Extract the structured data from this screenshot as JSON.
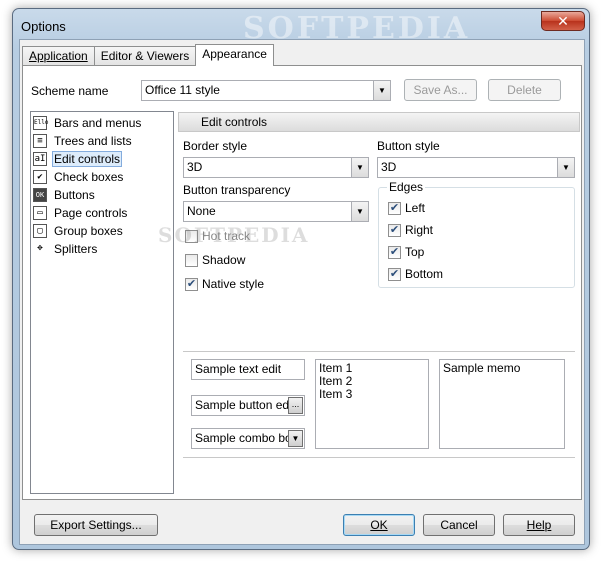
{
  "window": {
    "title": "Options",
    "watermark": "SOFTPEDIA",
    "close_glyph": "✕"
  },
  "tabs": [
    {
      "label": "Application"
    },
    {
      "label": "Editor & Viewers"
    },
    {
      "label": "Appearance"
    }
  ],
  "scheme": {
    "label": "Scheme name",
    "value": "Office 11 style",
    "save_as_label": "Save As...",
    "delete_label": "Delete"
  },
  "tree": [
    {
      "label": "Bars and menus",
      "icon": "Ello"
    },
    {
      "label": "Trees and lists",
      "icon": "≡"
    },
    {
      "label": "Edit controls",
      "icon": "aI"
    },
    {
      "label": "Check boxes",
      "icon": "✔"
    },
    {
      "label": "Buttons",
      "icon": "OK"
    },
    {
      "label": "Page controls",
      "icon": "▭"
    },
    {
      "label": "Group boxes",
      "icon": "▢"
    },
    {
      "label": "Splitters",
      "icon": "✥"
    }
  ],
  "section": {
    "title": "Edit controls",
    "border_style_label": "Border style",
    "border_style_value": "3D",
    "button_style_label": "Button style",
    "button_style_value": "3D",
    "button_transparency_label": "Button transparency",
    "button_transparency_value": "None",
    "checks": {
      "hot_track": "Hot track",
      "shadow": "Shadow",
      "native_style": "Native style"
    },
    "edges_title": "Edges",
    "edges": {
      "left": "Left",
      "right": "Right",
      "top": "Top",
      "bottom": "Bottom"
    }
  },
  "samples": {
    "text_edit": "Sample text edit",
    "button_edit": "Sample button edit",
    "combo_box": "Sample combo box",
    "list_items": [
      "Item 1",
      "Item 2",
      "Item 3"
    ],
    "memo": "Sample memo",
    "ellipsis": "..."
  },
  "footer": {
    "export_label": "Export Settings...",
    "ok_label": "OK",
    "cancel_label": "Cancel",
    "help_label": "Help"
  }
}
